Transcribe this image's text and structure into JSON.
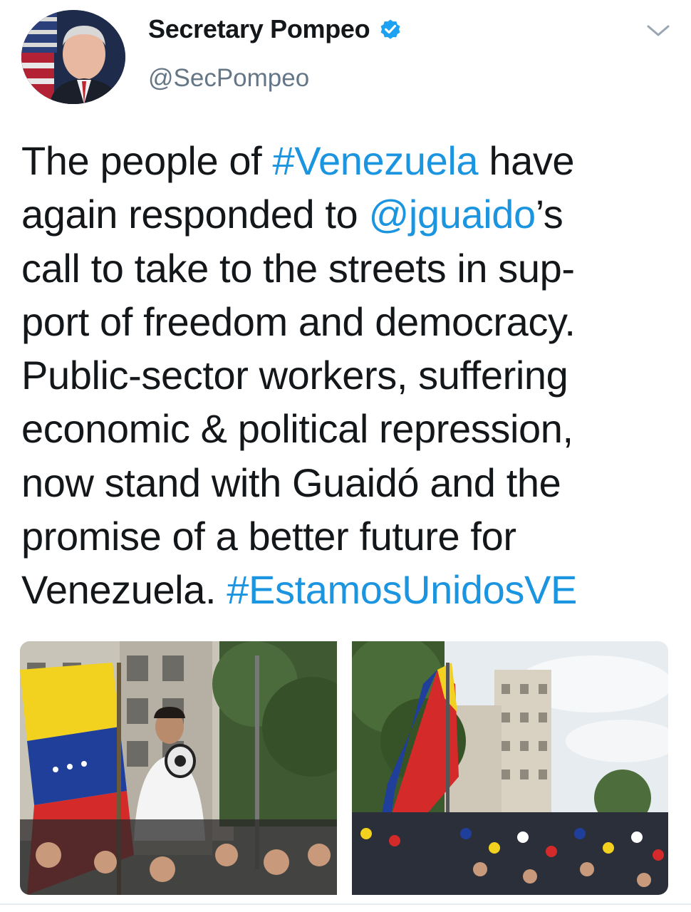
{
  "account": {
    "display_name": "Secretary Pompeo",
    "handle": "@SecPompeo",
    "verified": true,
    "avatar_icon": "profile-photo"
  },
  "tweet": {
    "lines": [
      [
        {
          "t": "The people of "
        },
        {
          "t": "#Venezuela",
          "link": true
        },
        {
          "t": " have"
        }
      ],
      [
        {
          "t": "again responded to "
        },
        {
          "t": "@jguaido",
          "link": true
        },
        {
          "t": "’s"
        }
      ],
      [
        {
          "t": "call to take to the streets in sup-"
        }
      ],
      [
        {
          "t": "port of freedom and democracy."
        }
      ],
      [
        {
          "t": "Public-sector workers, suffering"
        }
      ],
      [
        {
          "t": "economic & political repression,"
        }
      ],
      [
        {
          "t": "now stand with Guaidó and the"
        }
      ],
      [
        {
          "t": "promise of a better future for"
        }
      ],
      [
        {
          "t": "Venezuela. "
        },
        {
          "t": "#EstamosUnidosVE",
          "link": true
        }
      ]
    ]
  },
  "media": [
    {
      "icon": "protest-photo-megaphone"
    },
    {
      "icon": "protest-photo-crowd"
    }
  ],
  "icons": {
    "menu": "chevron-down-icon",
    "verified": "verified-badge-icon"
  },
  "colors": {
    "link": "#1b95e0",
    "text": "#14171a",
    "secondary": "#657786",
    "verified": "#1da1f2"
  }
}
